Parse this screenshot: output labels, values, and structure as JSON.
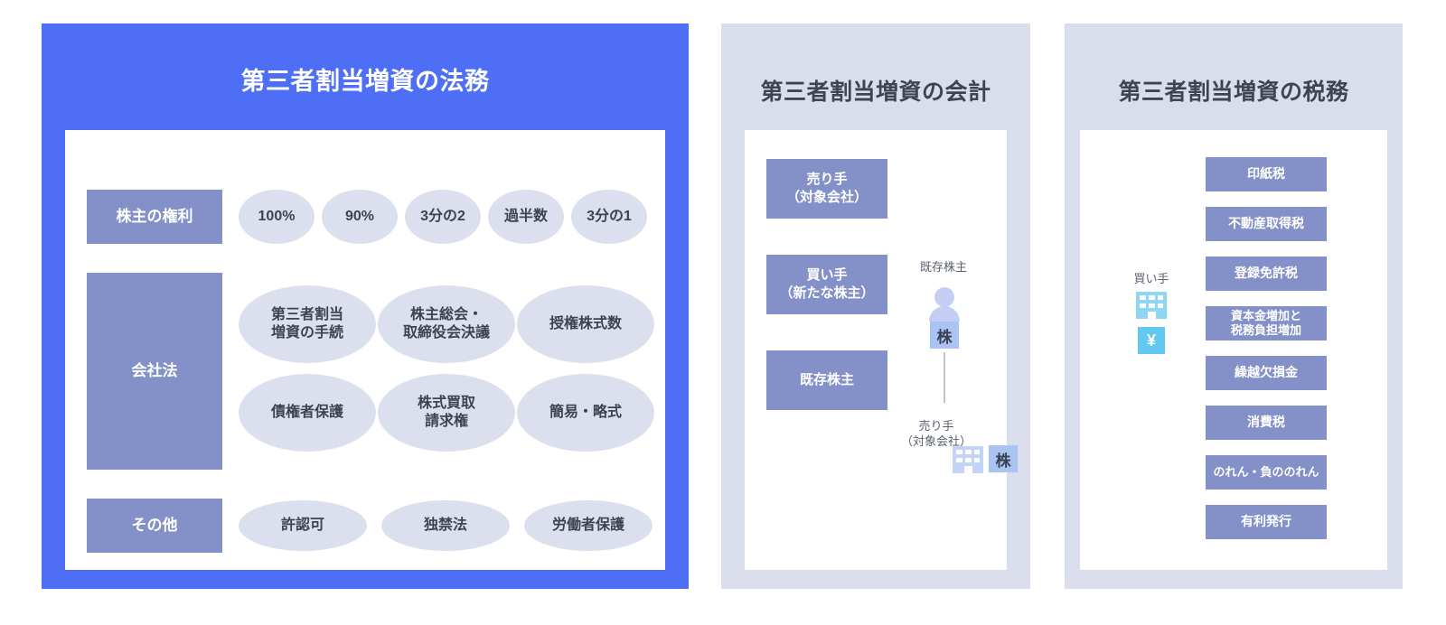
{
  "panels": {
    "legal": {
      "title": "第三者割当増資の法務",
      "accent_color": "#4f6ef6",
      "rows": [
        {
          "category": "株主の権利",
          "items": [
            "100%",
            "90%",
            "3分の2",
            "過半数",
            "3分の1"
          ]
        },
        {
          "category": "会社法",
          "items": [
            "第三者割当\n増資の手続",
            "株主総会・\n取締役会決議",
            "授権株式数",
            "債権者保護",
            "株式買取\n請求権",
            "簡易・略式"
          ]
        },
        {
          "category": "その他",
          "items": [
            "許認可",
            "独禁法",
            "労働者保護"
          ]
        }
      ]
    },
    "accounting": {
      "title": "第三者割当増資の会計",
      "accent_color": "#d9ddec",
      "actors": [
        "売り手\n（対象会社）",
        "買い手\n（新たな株主）",
        "既存株主"
      ],
      "diagram": {
        "existing_shareholder_label": "既存株主",
        "existing_shareholder_icon": "person-icon",
        "share_badge_top": "株",
        "seller_label": "売り手\n（対象会社）",
        "seller_icon": "building-icon",
        "share_badge_bottom": "株"
      }
    },
    "tax": {
      "title": "第三者割当増資の税務",
      "accent_color": "#d9ddec",
      "buyer": {
        "label": "買い手",
        "building_icon": "building-icon",
        "yen_badge": "¥",
        "yen_color": "#62c8f2"
      },
      "items": [
        "印紙税",
        "不動産取得税",
        "登録免許税",
        "資本金増加と\n税務負担増加",
        "繰越欠損金",
        "消費税",
        "のれん・負ののれん",
        "有利発行"
      ]
    }
  }
}
